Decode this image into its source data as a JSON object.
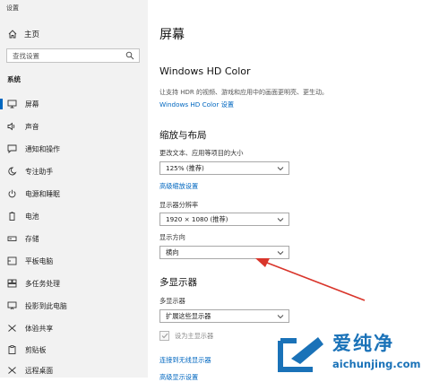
{
  "window": {
    "title": "设置"
  },
  "sidebar": {
    "home": {
      "label": "主页",
      "icon": "home-icon"
    },
    "search": {
      "placeholder": "查找设置",
      "icon": "search-icon"
    },
    "section_label": "系统",
    "items": [
      {
        "label": "屏幕",
        "icon": "monitor-icon",
        "active": true
      },
      {
        "label": "声音",
        "icon": "speaker-icon"
      },
      {
        "label": "通知和操作",
        "icon": "message-icon"
      },
      {
        "label": "专注助手",
        "icon": "moon-icon"
      },
      {
        "label": "电源和睡眠",
        "icon": "power-icon"
      },
      {
        "label": "电池",
        "icon": "battery-icon"
      },
      {
        "label": "存储",
        "icon": "storage-icon"
      },
      {
        "label": "平板电脑",
        "icon": "tablet-icon"
      },
      {
        "label": "多任务处理",
        "icon": "multitask-icon"
      },
      {
        "label": "投影到此电脑",
        "icon": "projector-icon"
      },
      {
        "label": "体验共享",
        "icon": "share-icon"
      },
      {
        "label": "剪贴板",
        "icon": "clipboard-icon"
      },
      {
        "label": "远程桌面",
        "icon": "remote-icon"
      }
    ]
  },
  "main": {
    "title": "屏幕",
    "hd_color": {
      "title": "Windows HD Color",
      "description": "让支持 HDR 的视频、游戏和应用中的画面更明亮、更生动。",
      "link": "Windows HD Color 设置"
    },
    "scale_layout": {
      "title": "缩放与布局",
      "text_size_label": "更改文本、应用等项目的大小",
      "text_size_value": "125% (推荐)",
      "advanced_link": "高级缩放设置",
      "resolution_label": "显示器分辨率",
      "resolution_value": "1920 × 1080 (推荐)",
      "orientation_label": "显示方向",
      "orientation_value": "横向"
    },
    "multi_display": {
      "title": "多显示器",
      "label": "多显示器",
      "value": "扩展这些显示器",
      "main_display_checkbox": "设为主显示器",
      "checked": true,
      "wireless_link": "连接到无线显示器",
      "last_link": "高级显示设置"
    }
  },
  "annotation": {
    "color": "#d9352b"
  },
  "watermark": {
    "title": "爱纯净",
    "url": "aichunjing.com",
    "color": "#1a72b8"
  },
  "colors": {
    "accent": "#0067c0",
    "sidebar_bg": "#f2f2f2"
  }
}
